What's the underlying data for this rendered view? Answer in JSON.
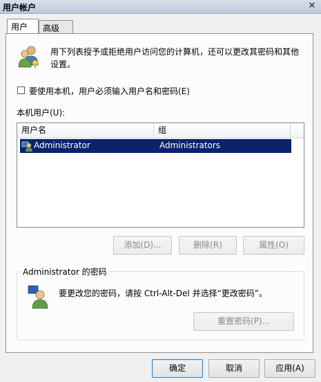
{
  "window": {
    "title": "用户帐户",
    "close_glyph": "✕"
  },
  "tabs": [
    {
      "label": "用户",
      "active": true
    },
    {
      "label": "高级",
      "active": false
    }
  ],
  "description": "用下列表授予或拒绝用户访问您的计算机，还可以更改其密码和其他设置。",
  "require_login": {
    "label": "要使用本机，用户必须输入用户名和密码(E)",
    "checked": false
  },
  "local_users": {
    "label": "本机用户(U):",
    "columns": [
      "用户名",
      "组"
    ],
    "rows": [
      {
        "name": "Administrator",
        "group": "Administrators",
        "selected": true
      }
    ]
  },
  "list_buttons": {
    "add": "添加(D)...",
    "remove": "删除(R)",
    "properties": "属性(O)"
  },
  "password_group": {
    "title": "Administrator 的密码",
    "text": "要更改您的密码，请按 Ctrl-Alt-Del 并选择“更改密码”。",
    "reset_button": "重置密码(P)..."
  },
  "dialog_buttons": {
    "ok": "确定",
    "cancel": "取消",
    "apply": "应用(A)"
  },
  "colors": {
    "selection": "#0a246a",
    "panel": "#fcfcfc",
    "window": "#f0f0f0"
  },
  "icons": [
    "users-icon",
    "user-row-icon",
    "password-user-icon",
    "close-icon"
  ]
}
